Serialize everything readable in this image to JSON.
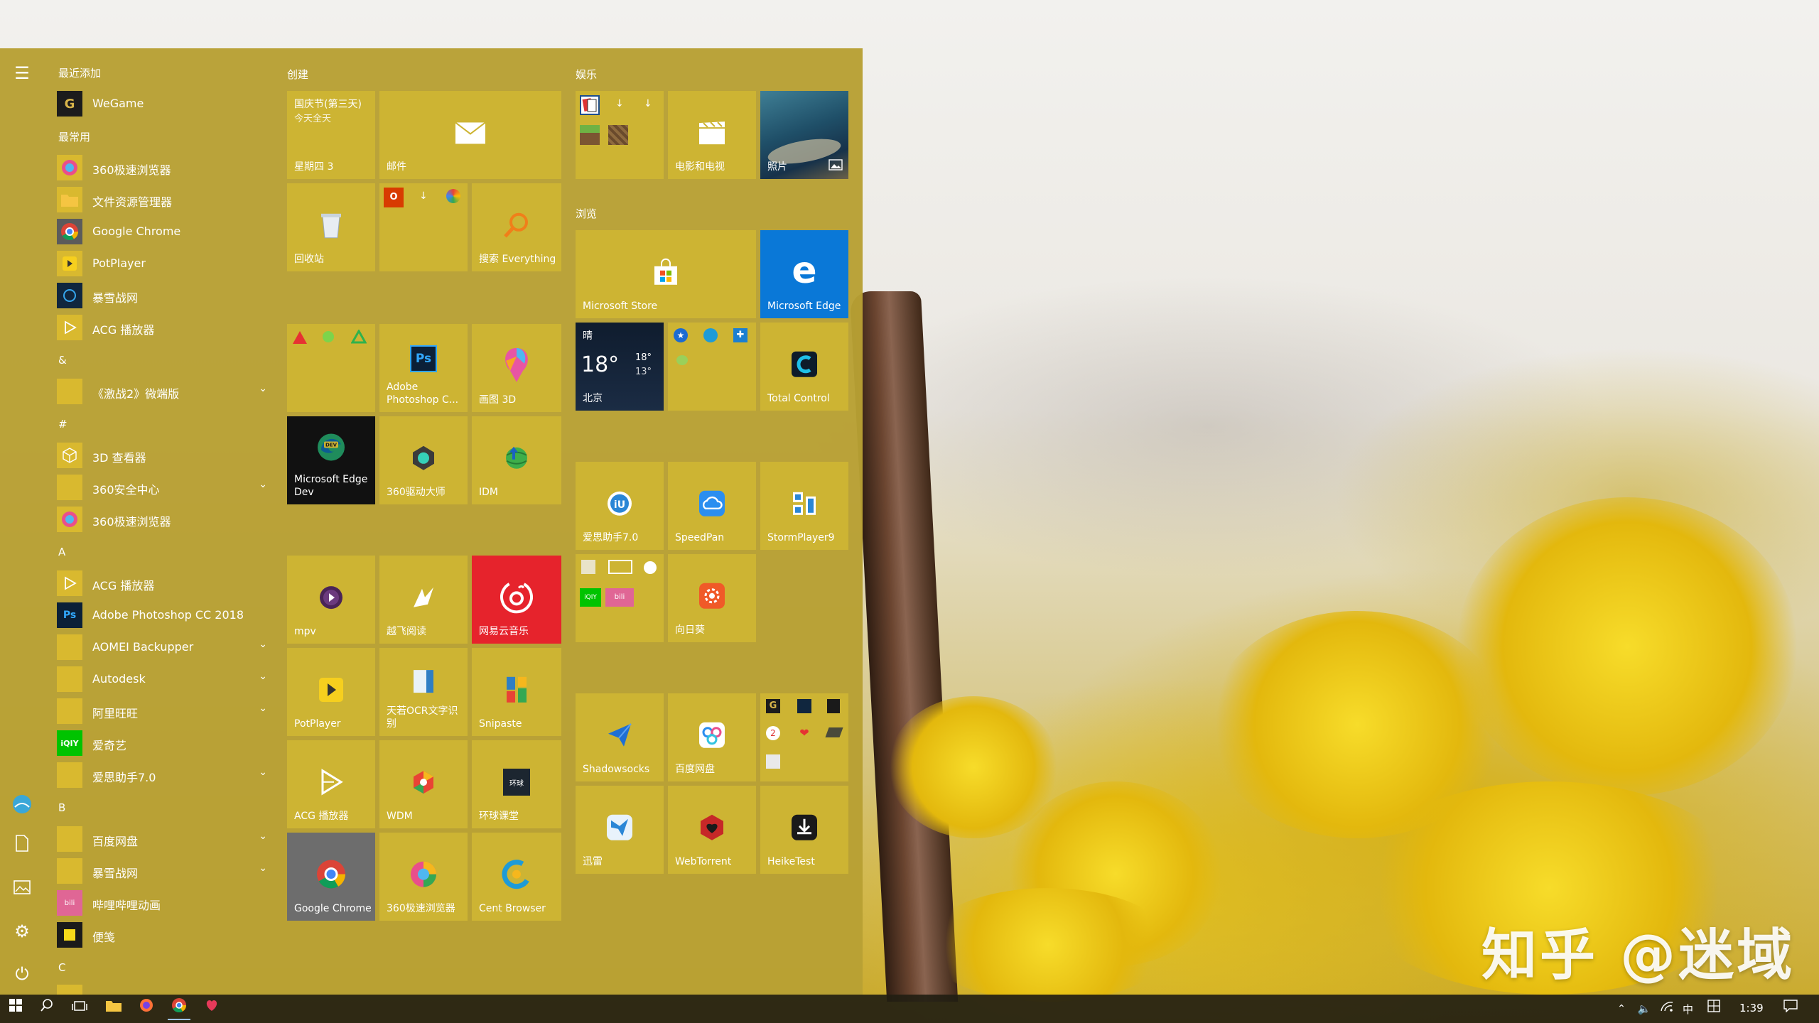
{
  "watermark": "知乎 @迷域",
  "app_list": {
    "recently_added_header": "最近添加",
    "most_used_header": "最常用",
    "items": [
      {
        "label": "WeGame",
        "icon": "wegame-icon"
      },
      {
        "label": "360极速浏览器",
        "icon": "browser-360-icon"
      },
      {
        "label": "文件资源管理器",
        "icon": "folder-icon"
      },
      {
        "label": "Google Chrome",
        "icon": "chrome-icon"
      },
      {
        "label": "PotPlayer",
        "icon": "potplayer-icon"
      },
      {
        "label": "暴雪战网",
        "icon": "battlenet-icon"
      },
      {
        "label": "ACG 播放器",
        "icon": "play-triangle-icon"
      }
    ],
    "alpha_sections": [
      {
        "letter": "&"
      },
      {
        "letter": "#"
      },
      {
        "letter": "A"
      },
      {
        "letter": "B"
      },
      {
        "letter": "C"
      }
    ],
    "alpha_items": [
      {
        "label": "《激战2》微端版",
        "expandable": true
      },
      {
        "label": "3D 查看器",
        "expandable": false
      },
      {
        "label": "360安全中心",
        "expandable": true
      },
      {
        "label": "360极速浏览器",
        "expandable": false
      },
      {
        "label": "ACG 播放器",
        "expandable": false
      },
      {
        "label": "Adobe Photoshop CC 2018",
        "expandable": false
      },
      {
        "label": "AOMEI Backupper",
        "expandable": true
      },
      {
        "label": "Autodesk",
        "expandable": true
      },
      {
        "label": "阿里旺旺",
        "expandable": true
      },
      {
        "label": "爱奇艺",
        "expandable": false
      },
      {
        "label": "爱思助手7.0",
        "expandable": true
      },
      {
        "label": "百度网盘",
        "expandable": true
      },
      {
        "label": "暴雪战网",
        "expandable": true
      },
      {
        "label": "哔哩哔哩动画",
        "expandable": false
      },
      {
        "label": "便笺",
        "expandable": false
      }
    ]
  },
  "groups": {
    "create": "创建",
    "entertainment": "娱乐",
    "browse": "浏览"
  },
  "tiles": {
    "calendar_event": "国庆节(第三天)",
    "calendar_sub": "今天全天",
    "calendar_day": "星期四 3",
    "mail": "邮件",
    "recycle": "回收站",
    "everything": "搜索 Everything",
    "photoshop": "Adobe Photoshop C...",
    "paint3d": "画图 3D",
    "edge_dev": "Microsoft Edge Dev",
    "driver360": "360驱动大师",
    "idm": "IDM",
    "mpv": "mpv",
    "yuefei": "越飞阅读",
    "netease": "网易云音乐",
    "potplayer": "PotPlayer",
    "ocr": "天若OCR文字识别",
    "snipaste": "Snipaste",
    "acg": "ACG 播放器",
    "wdm": "WDM",
    "hqkt": "环球课堂",
    "chrome": "Google Chrome",
    "browser360": "360极速浏览器",
    "cent": "Cent Browser",
    "movies": "电影和电视",
    "photos": "照片",
    "store": "Microsoft Store",
    "edge": "Microsoft Edge",
    "weather_cond": "晴",
    "weather_temp": "18°",
    "weather_hi": "18°",
    "weather_lo": "13°",
    "weather_city": "北京",
    "total_control": "Total Control",
    "aisi": "爱思助手7.0",
    "speedpan": "SpeedPan",
    "stormplayer": "StormPlayer9",
    "xiangrikui": "向日葵",
    "shadowsocks": "Shadowsocks",
    "baidupan": "百度网盘",
    "xunlei": "迅雷",
    "webtorrent": "WebTorrent",
    "heiketest": "HeikeTest"
  },
  "taskbar": {
    "ime": "中",
    "clock": "1:39"
  }
}
